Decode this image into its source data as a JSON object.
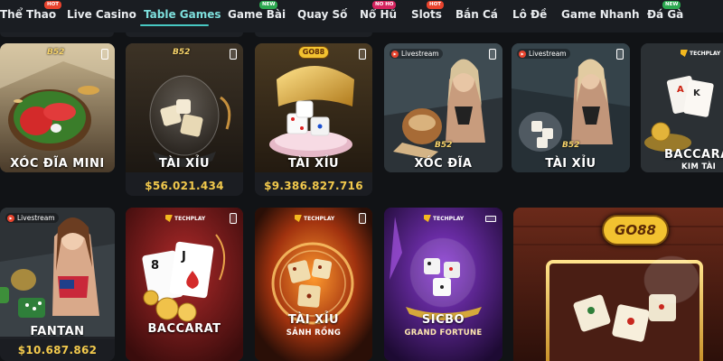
{
  "nav": {
    "items": [
      {
        "label": "Thể Thao",
        "badge": "HOT"
      },
      {
        "label": "Live Casino"
      },
      {
        "label": "Table Games",
        "active": true
      },
      {
        "label": "Game Bài",
        "badge": "NEW"
      },
      {
        "label": "Quay Số"
      },
      {
        "label": "Nổ Hũ",
        "badge": "NO HO"
      },
      {
        "label": "Slots",
        "badge": "HOT"
      },
      {
        "label": "Bắn Cá"
      },
      {
        "label": "Lô Đề"
      },
      {
        "label": "Game Nhanh"
      },
      {
        "label": "Đá Gà",
        "badge": "NEW"
      }
    ]
  },
  "games": [
    {
      "title": "XÓC ĐĨA MINI",
      "provider_logo": "B52"
    },
    {
      "title": "TÀI XỈU",
      "provider_logo": "B52",
      "jackpot": "$56.021.434"
    },
    {
      "title": "TÀI XỈU",
      "provider_logo": "GO88",
      "jackpot": "$9.386.827.716"
    },
    {
      "title": "XÓC ĐĨA",
      "live": "Livestream",
      "provider_logo": "B52"
    },
    {
      "title": "TÀI XỈU",
      "live": "Livestream",
      "provider_logo": "B52"
    },
    {
      "title": "BACCARA",
      "subtitle": "KIM TÀI",
      "brand": "TECHPLAY"
    },
    {
      "title": "FANTAN",
      "live": "Livestream",
      "jackpot": "$10.687.862"
    },
    {
      "title": "BACCARAT",
      "brand": "TECHPLAY"
    },
    {
      "title": "TÀI XỈU",
      "subtitle": "SẢNH RỒNG",
      "brand": "TECHPLAY"
    },
    {
      "title": "SICBO",
      "subtitle": "GRAND FORTUNE",
      "brand": "TECHPLAY"
    },
    {
      "title": "",
      "provider_logo": "GO88"
    }
  ],
  "colors": {
    "accent": "#47c7c2",
    "jackpot": "#f2c94c",
    "hot": "#e8432d",
    "new": "#2ca850"
  }
}
